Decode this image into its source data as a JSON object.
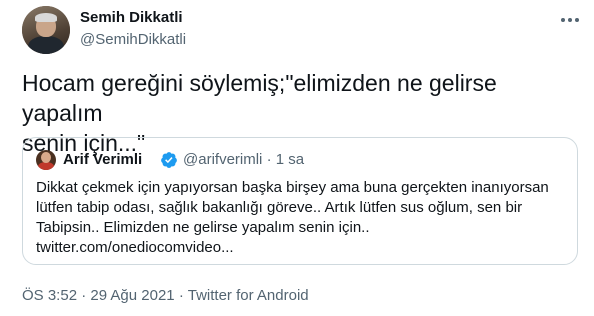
{
  "author": {
    "name": "Semih Dikkatli",
    "handle": "@SemihDikkatli"
  },
  "menu_icon": "more-horizontal-icon",
  "tweet_text": {
    "line1": "Hocam gereğini söylemiş;\"elimizden ne gelirse yapalım",
    "line2": "senin için...\""
  },
  "quoted_tweet": {
    "name": "Arif Verimli",
    "verified_icon": "verified-badge-icon",
    "handle": "@arifverimli",
    "separator": "·",
    "time": "1 sa",
    "lines": [
      "Dikkat çekmek için yapıyorsan başka birşey ama buna gerçekten inanıyorsan",
      "lütfen tabip odası, sağlık bakanlığı göreve.. Artık lütfen sus oğlum, sen bir",
      "Tabipsin.. Elimizden ne gelirse yapalım senin için..",
      "twitter.com/onediocomvideo..."
    ]
  },
  "footer": {
    "time": "ÖS 3:52",
    "date": "29 Ağu 2021",
    "source": "Twitter for Android",
    "separator": "·"
  },
  "colors": {
    "text": "#0f1419",
    "secondary": "#536471",
    "border": "#cfd9de",
    "verified": "#1d9bf0"
  }
}
